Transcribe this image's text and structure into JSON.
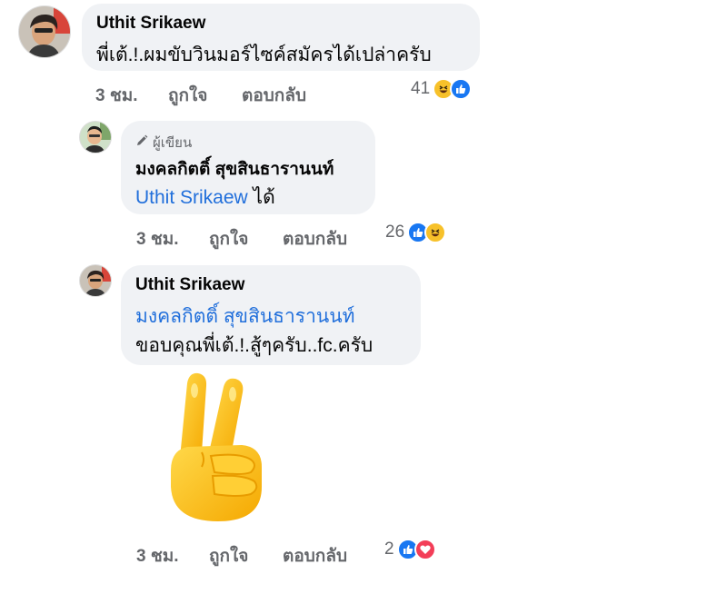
{
  "comments": [
    {
      "author": "Uthit Srikaew",
      "text": "พี่เต้.!.ผมขับวินมอร์ไซค์สมัครได้เปล่าครับ",
      "time": "3 ชม.",
      "like_label": "ถูกใจ",
      "reply_label": "ตอบกลับ",
      "reaction_count": "41",
      "reactions": [
        "haha-icon",
        "like-icon"
      ]
    }
  ],
  "replies": [
    {
      "author_badge": "ผู้เขียน",
      "author": "มงคลกิตติ์ สุขสินธารานนท์",
      "mention": "Uthit Srikaew",
      "text": " ได้",
      "time": "3 ชม.",
      "like_label": "ถูกใจ",
      "reply_label": "ตอบกลับ",
      "reaction_count": "26",
      "reactions": [
        "like-icon",
        "haha-icon"
      ]
    },
    {
      "author": "Uthit Srikaew",
      "mention": "มงคลกิตติ์ สุขสินธารานนท์",
      "text": "ขอบคุณพี่เต้.!.สู้ๆครับ..fc.ครับ",
      "sticker": "victory-hand-emoji",
      "time": "3 ชม.",
      "like_label": "ถูกใจ",
      "reply_label": "ตอบกลับ",
      "reaction_count": "2",
      "reactions": [
        "like-icon",
        "love-icon"
      ]
    }
  ],
  "colors": {
    "bubble": "#f0f2f5",
    "mention": "#216fdb",
    "meta": "#65676b",
    "like": "#1877f2",
    "love": "#f33e58",
    "haha": "#f7c12a"
  }
}
